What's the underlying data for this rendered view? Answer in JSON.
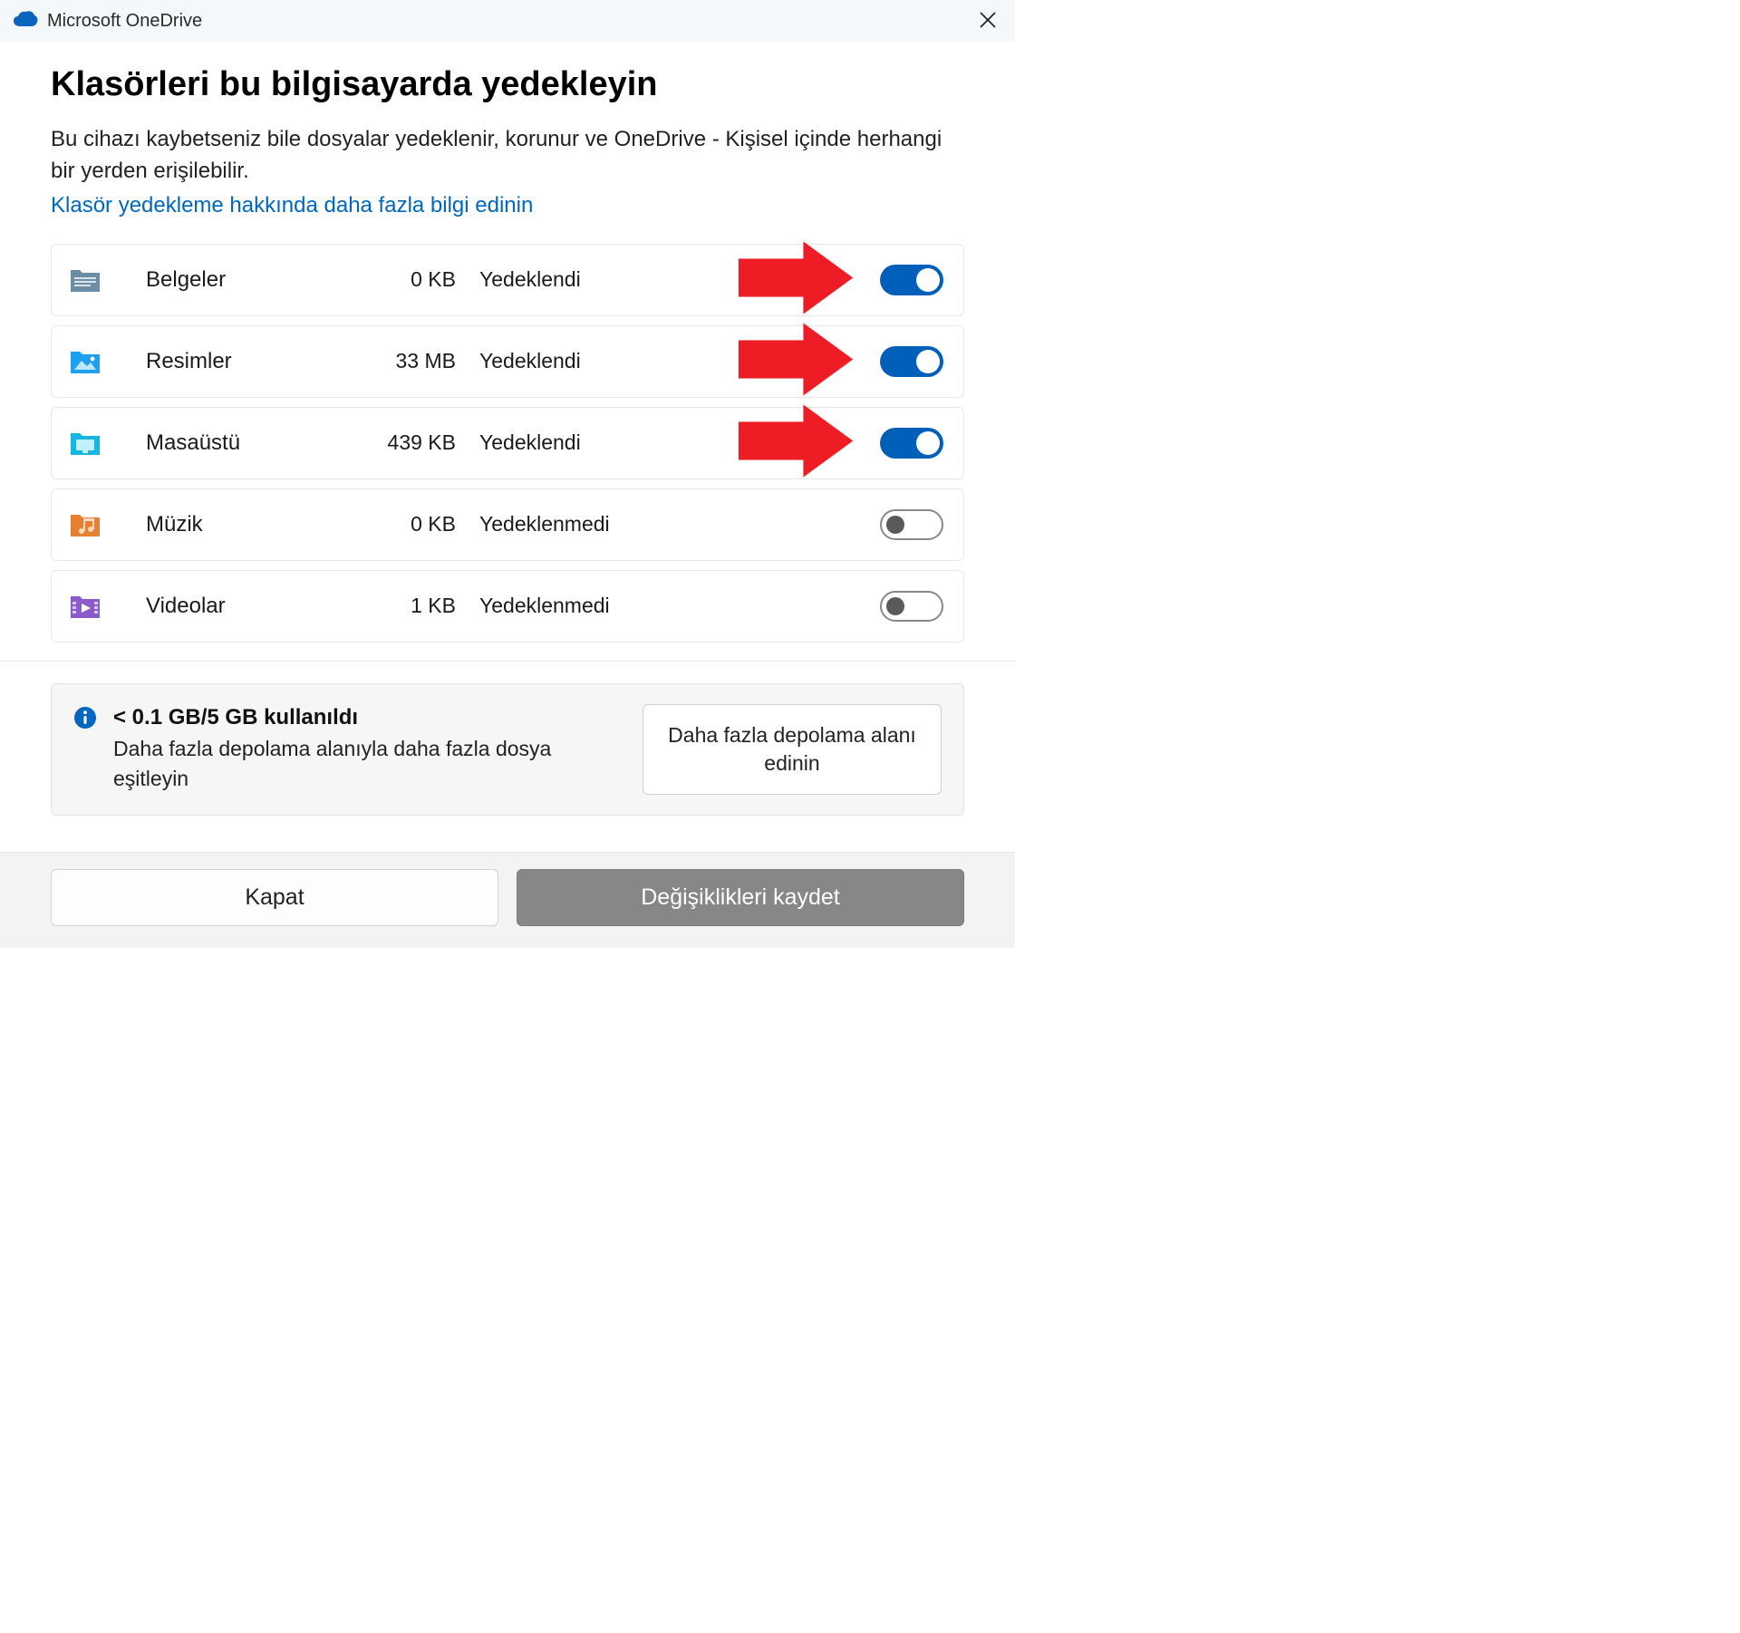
{
  "titlebar": {
    "title": "Microsoft OneDrive"
  },
  "header": {
    "heading": "Klasörleri bu bilgisayarda yedekleyin",
    "subtitle": "Bu cihazı kaybetseniz bile dosyalar yedeklenir, korunur ve OneDrive - Kişisel içinde herhangi bir yerden erişilebilir.",
    "learn_more": "Klasör yedekleme hakkında daha fazla bilgi edinin"
  },
  "folders": [
    {
      "name": "Belgeler",
      "size": "0 KB",
      "status": "Yedeklendi",
      "on": true,
      "arrow": true,
      "icon": "documents"
    },
    {
      "name": "Resimler",
      "size": "33 MB",
      "status": "Yedeklendi",
      "on": true,
      "arrow": true,
      "icon": "pictures"
    },
    {
      "name": "Masaüstü",
      "size": "439 KB",
      "status": "Yedeklendi",
      "on": true,
      "arrow": true,
      "icon": "desktop"
    },
    {
      "name": "Müzik",
      "size": "0 KB",
      "status": "Yedeklenmedi",
      "on": false,
      "arrow": false,
      "icon": "music"
    },
    {
      "name": "Videolar",
      "size": "1 KB",
      "status": "Yedeklenmedi",
      "on": false,
      "arrow": false,
      "icon": "videos"
    }
  ],
  "storage": {
    "title": "< 0.1 GB/5 GB kullanıldı",
    "subtitle": "Daha fazla depolama alanıyla daha fazla dosya eşitleyin",
    "button": "Daha fazla depolama alanı edinin"
  },
  "footer": {
    "close": "Kapat",
    "save": "Değişiklikleri kaydet"
  }
}
